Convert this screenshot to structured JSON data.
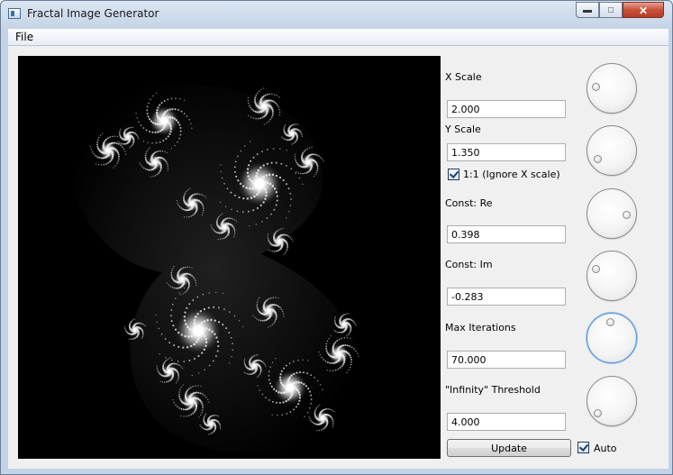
{
  "window": {
    "title": "Fractal Image Generator",
    "minimize": "▬",
    "maximize": "□",
    "close": "✕"
  },
  "menu": {
    "items": [
      "File"
    ]
  },
  "controls": {
    "x_scale": {
      "label": "X Scale",
      "value": "2.000"
    },
    "y_scale": {
      "label": "Y Scale",
      "value": "1.350"
    },
    "ignore_x": {
      "label": "1:1 (Ignore X scale)",
      "checked": true
    },
    "const_re": {
      "label": "Const: Re",
      "value": "0.398"
    },
    "const_im": {
      "label": "Const: Im",
      "value": "-0.283"
    },
    "max_iter": {
      "label": "Max Iterations",
      "value": "70.000"
    },
    "threshold": {
      "label": "\"Infinity\" Threshold",
      "value": "4.000"
    },
    "update": {
      "label": "Update"
    },
    "auto": {
      "label": "Auto",
      "checked": true
    }
  },
  "icons": [
    "app-window-icon",
    "x-scale-dial",
    "y-scale-dial",
    "const-re-dial",
    "const-im-dial",
    "max-iterations-dial",
    "threshold-dial",
    "check-icon"
  ]
}
